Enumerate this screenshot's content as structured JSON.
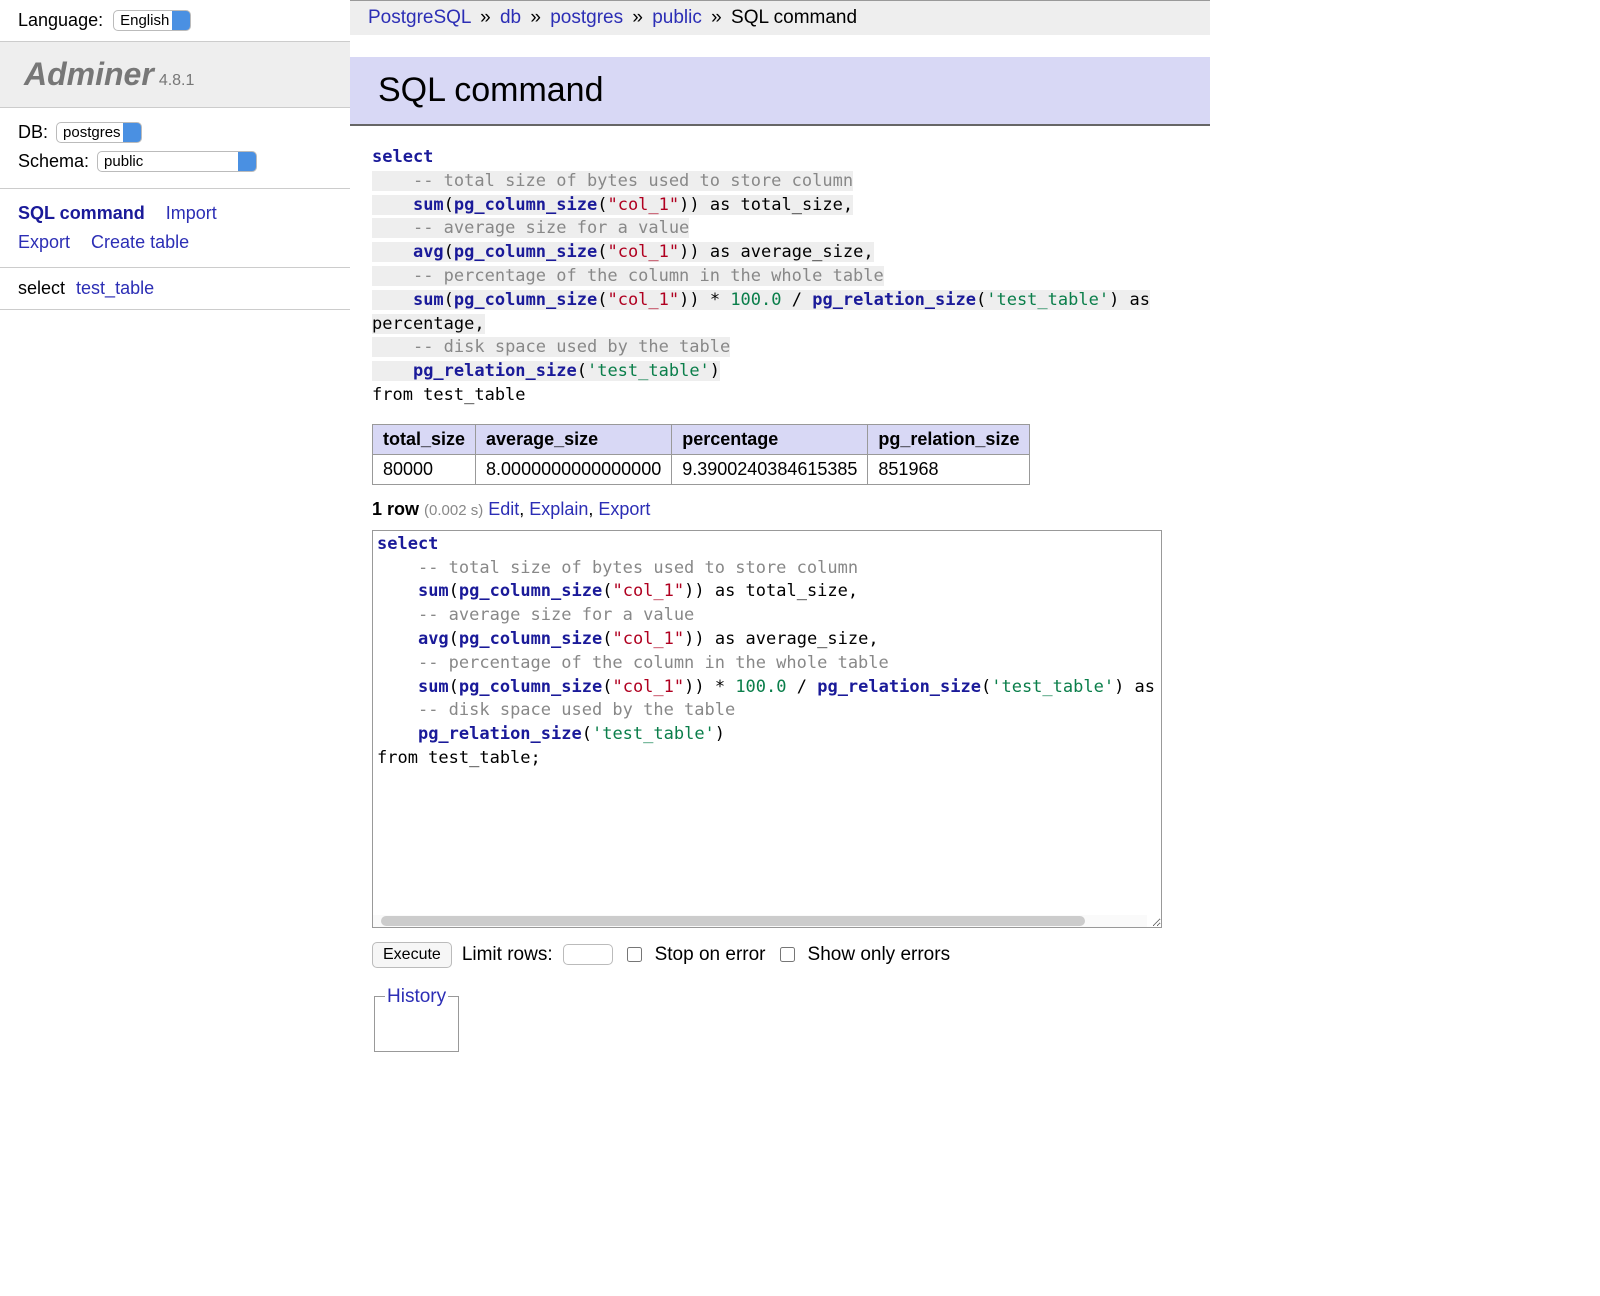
{
  "sidebar": {
    "language_label": "Language:",
    "language_value": "English",
    "logo_title": "Adminer",
    "logo_version": "4.8.1",
    "db_label": "DB:",
    "db_value": "postgres",
    "schema_label": "Schema:",
    "schema_value": "public",
    "nav": {
      "sql_command": "SQL command",
      "import": "Import",
      "export": "Export",
      "create_table": "Create table"
    },
    "tables": {
      "select_label": "select",
      "table_name": "test_table"
    }
  },
  "breadcrumb": {
    "driver": "PostgreSQL",
    "db_label": "db",
    "db_name": "postgres",
    "schema": "public",
    "current": "SQL command"
  },
  "page_title": "SQL command",
  "query_display": {
    "line1_kw": "select",
    "cmt1": "-- total size of bytes used to store column",
    "l2a": "sum",
    "l2b": "pg_column_size",
    "l2c": "\"col_1\"",
    "l2r": ")) as total_size,",
    "cmt2": "-- average size for a value",
    "l3a": "avg",
    "l3b": "pg_column_size",
    "l3c": "\"col_1\"",
    "l3r": ")) as average_size,",
    "cmt3": "-- percentage of the column in the whole table",
    "l4a": "sum",
    "l4b": "pg_column_size",
    "l4c": "\"col_1\"",
    "l4mid": ")) * ",
    "l4num": "100.0",
    "l4div": " / ",
    "l4fn": "pg_relation_size",
    "l4str": "'test_table'",
    "l4end": ") as percentage,",
    "cmt4": "-- disk space used by the table",
    "l5fn": "pg_relation_size",
    "l5str": "'test_table'",
    "l5end": ")",
    "from_line": "from test_table"
  },
  "result": {
    "headers": [
      "total_size",
      "average_size",
      "percentage",
      "pg_relation_size"
    ],
    "row": [
      "80000",
      "8.0000000000000000",
      "9.3900240384615385",
      "851968"
    ]
  },
  "row_info": {
    "count": "1 row",
    "time": "(0.002 s)",
    "edit": "Edit",
    "explain": "Explain",
    "export": "Export"
  },
  "editor": {
    "line1_kw": "select",
    "cmt1": "-- total size of bytes used to store column",
    "l2a": "sum",
    "l2b": "pg_column_size",
    "l2c": "\"col_1\"",
    "l2r": ")) as total_size,",
    "cmt2": "-- average size for a value",
    "l3a": "avg",
    "l3b": "pg_column_size",
    "l3c": "\"col_1\"",
    "l3r": ")) as average_size,",
    "cmt3": "-- percentage of the column in the whole table",
    "l4a": "sum",
    "l4b": "pg_column_size",
    "l4c": "\"col_1\"",
    "l4mid": ")) * ",
    "l4num": "100.0",
    "l4div": " / ",
    "l4fn": "pg_relation_size",
    "l4str": "'test_table'",
    "l4end": ") as percentage,",
    "cmt4": "-- disk space used by the table",
    "l5fn": "pg_relation_size",
    "l5str": "'test_table'",
    "l5end": ")",
    "from_line": "from test_table;"
  },
  "controls": {
    "execute": "Execute",
    "limit_rows": "Limit rows:",
    "stop_on_error": "Stop on error",
    "show_only_errors": "Show only errors"
  },
  "history_label": "History"
}
